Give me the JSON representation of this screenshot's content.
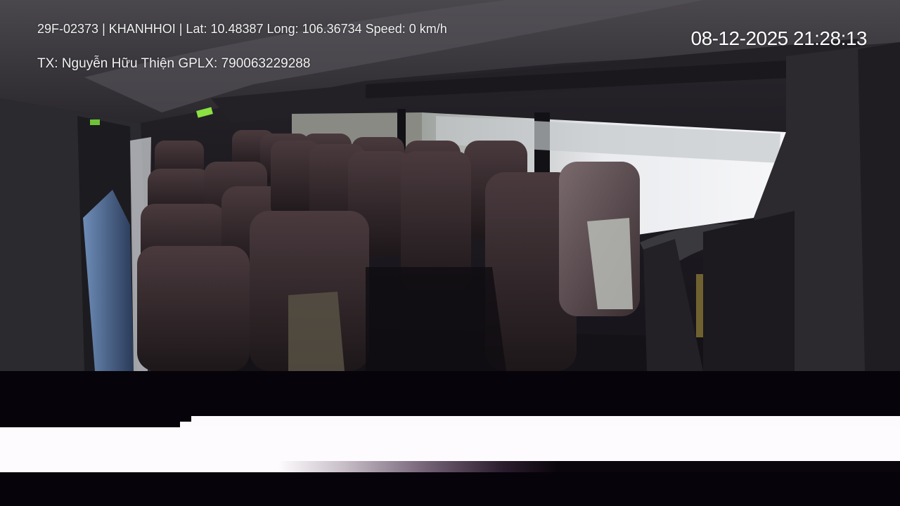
{
  "overlay": {
    "line1": "29F-02373 | KHANHHOI | Lat: 10.48387 Long: 106.36734 Speed: 0 km/h",
    "line2": "TX: Nguyễn Hữu Thiện GPLX: 790063229288",
    "timestamp": "08-12-2025 21:28:13"
  },
  "scene": {
    "description_icon": "bus-interior-camera-view"
  }
}
